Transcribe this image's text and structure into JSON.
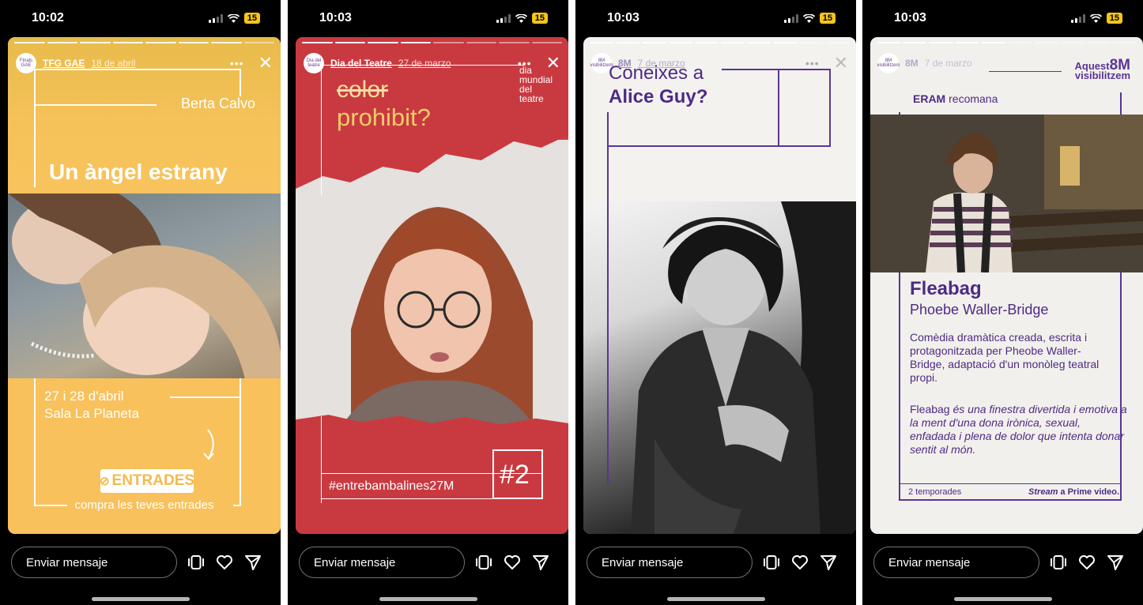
{
  "status_bars": [
    {
      "time": "10:02",
      "battery": "15"
    },
    {
      "time": "10:03",
      "battery": "15"
    },
    {
      "time": "10:03",
      "battery": "15"
    },
    {
      "time": "10:03",
      "battery": "15"
    }
  ],
  "stories": [
    {
      "avatar_text": "Finals GAE",
      "username": "TFG GAE",
      "date": "18 de abril",
      "name": "Berta Calvo",
      "title": "Un àngel estrany",
      "dates_line1": "27 i 28 d'abril",
      "dates_line2": "Sala La Planeta",
      "button": "ENTRADES",
      "button_icon": "link-icon",
      "caption": "compra les teves entrades",
      "colors": {
        "bg": "#f7c25b"
      }
    },
    {
      "avatar_text": "Dia del teatre",
      "username": "Dia del Teatre",
      "date": "27 de marzo",
      "strike": "color",
      "title": "prohibit?",
      "side_1": "dia",
      "side_2": "mundial",
      "side_3": "del",
      "side_4": "teatre",
      "hashtag": "#entrebambalines27M",
      "number": "#2",
      "colors": {
        "bg": "#c93a40"
      }
    },
    {
      "avatar_text": "8M visibilitzem",
      "username": "8M",
      "date": "7 de marzo",
      "q1": "Coneixes a",
      "q2": "Alice Guy?",
      "colors": {
        "accent": "#5a3596"
      }
    },
    {
      "avatar_text": "8M visibilitzem",
      "username": "8M",
      "date": "7 de marzo",
      "aquest": "Aquest",
      "aquest_tag": "8M",
      "visibilitzem": "visibilitzem",
      "eram": "ERAM",
      "recomana": "recomana",
      "title": "Fleabag",
      "author": "Phoebe Waller-Bridge",
      "desc": "Comèdia dramàtica creada, escrita i protagonitzada per Pheobe Waller-Bridge, adaptació d'un monòleg teatral propi.",
      "quote_prefix": "Fleabag",
      "quote": "és una finestra divertida i emotiva a la ment d'una dona irònica, sexual, enfadada i plena de dolor que intenta donar sentit al món.",
      "seasons": "2 temporades",
      "stream_a": "Stream",
      "stream_b": "a Prime video.",
      "colors": {
        "accent": "#4d2b86"
      }
    }
  ],
  "reply": {
    "placeholder": "Enviar mensaje"
  }
}
